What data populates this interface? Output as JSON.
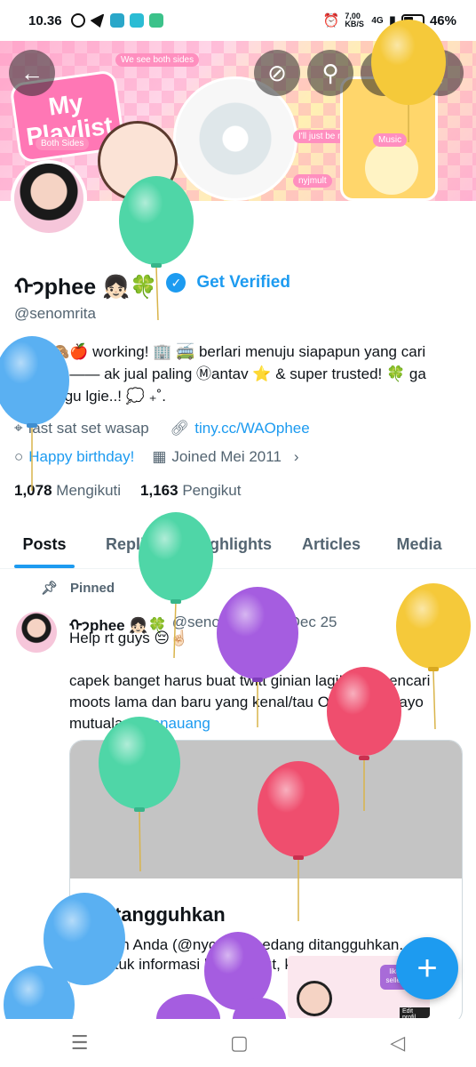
{
  "status_bar": {
    "time": "10.36",
    "network": "7,00 KB/S",
    "signal": "4G",
    "battery": "46%"
  },
  "banner": {
    "title_text": "My Playlist",
    "tag1": "We see both sides",
    "tag2": "Both Sides",
    "tag3": "I'll just be me",
    "tag4": "Music",
    "tag5": "nyjmult"
  },
  "profile": {
    "name": "ᡣ𐭩phee 👧🏻🍀",
    "get_verified": "Get Verified",
    "handle": "@senomrita",
    "bio": "⋆ ˚. ⋆🙈🍎 working! 🏢 🚎 berlari menuju siapapun yang cari apprem —— ak jual paling Ⓜantav ⭐ & super trusted! 🍀 ga usah ragu lgie..! 💭 ₊˚.",
    "location": "fast sat set wasap",
    "website": "tiny.cc/WAOphee",
    "birthday": "Happy birthday!",
    "joined": "Joined Mei 2011",
    "following_count": "1,078",
    "following_label": "Mengikuti",
    "followers_count": "1,163",
    "followers_label": "Pengikut"
  },
  "tabs": [
    "Posts",
    "Replies",
    "Highlights",
    "Articles",
    "Media"
  ],
  "tweet": {
    "pinned_label": "Pinned",
    "name": "ᡣ𐭩phee 👧🏻🍀",
    "handle": "@senomrita",
    "date": "· 16 Dec 25",
    "line1": "Help rt guys 😔☝🏻",
    "line2": "capek banget harus buat twitt ginian lagi!!##$ mencari moots lama dan baru yang kenal/tau Ophee t pls ayo mutualan",
    "hashtag": "#zonauang",
    "card_title": "Ditangguhkan",
    "card_desc": "Akun Anda (@nyc.mut) sedang ditangguhkan. Untuk informasi lebih lanjut, kunjungi x.com."
  },
  "mini_ad": {
    "caption": "like best seller ever",
    "button": "Edit profil"
  },
  "fab_label": "+",
  "colors": {
    "accent": "#1d9bf0",
    "text": "#0f1419",
    "muted": "#536471"
  },
  "balloon_colors": [
    "#4fd6a7",
    "#5ab0f2",
    "#a55de0",
    "#f5c93a",
    "#ef4e6e"
  ]
}
